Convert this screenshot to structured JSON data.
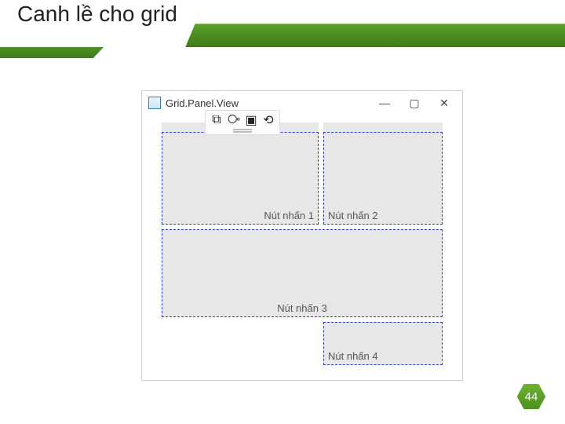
{
  "slide": {
    "title": "Canh lề cho grid",
    "page_number": "44"
  },
  "window": {
    "title": "Grid.Panel.View",
    "buttons": {
      "minimize": "—",
      "maximize": "▢",
      "close": "✕"
    },
    "toolbar_icons": [
      "⧉",
      "⧂",
      "▣",
      "⟲"
    ],
    "cells": {
      "c1": "Nút nhấn 1",
      "c2": "Nút nhấn 2",
      "c3": "Nút nhấn 3",
      "c4": "Nút nhấn 4"
    }
  }
}
